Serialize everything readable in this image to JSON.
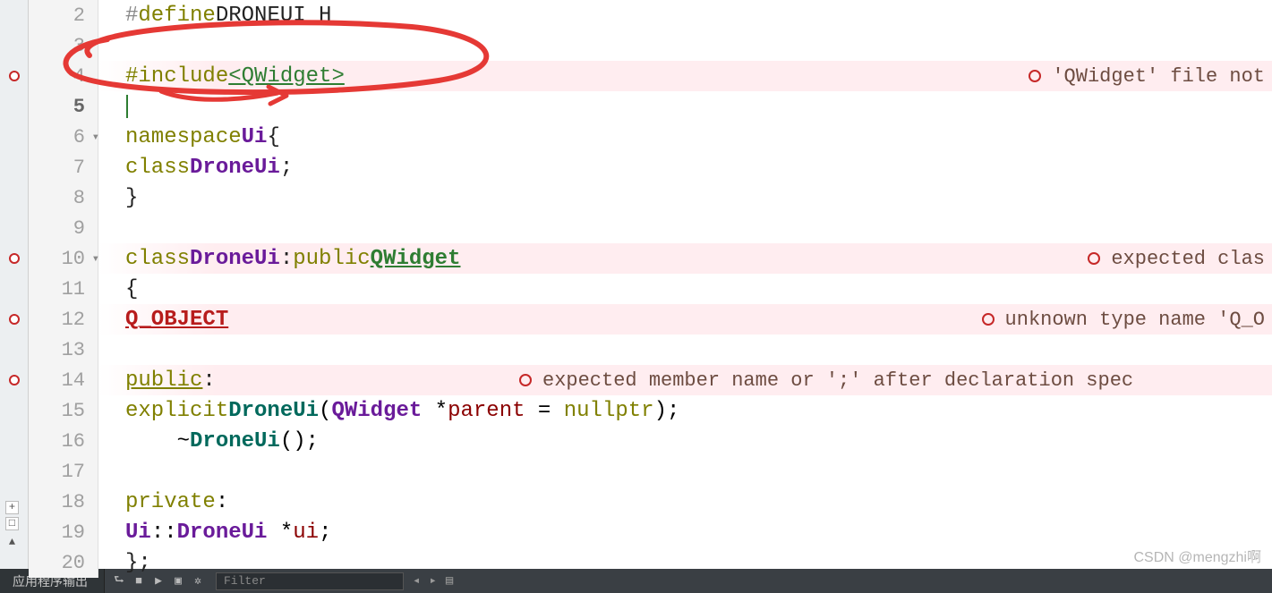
{
  "editor": {
    "lines": [
      {
        "n": 2,
        "break": false,
        "fold": false,
        "err": false,
        "inline": "",
        "html": "<span class='kw-gray'>#</span><span class='kw-olive'>define</span> <span class='kw-black'>DRONEUI_H</span>"
      },
      {
        "n": 3,
        "break": false,
        "fold": false,
        "err": false,
        "inline": "",
        "html": ""
      },
      {
        "n": 4,
        "break": true,
        "fold": false,
        "err": true,
        "inline": "'QWidget' file not",
        "html": "<span class='kw-olive'>#include</span> <span class='kw-green'>&lt;QWidget&gt;</span>"
      },
      {
        "n": 5,
        "break": false,
        "fold": false,
        "err": false,
        "inline": "",
        "html": "<span class='cursor-bar'></span>",
        "current": true
      },
      {
        "n": 6,
        "break": false,
        "fold": true,
        "err": false,
        "inline": "",
        "html": "<span class='kw-olive'>namespace</span> <span class='kw-purple'>Ui</span> <span class='kw-black'>{</span>"
      },
      {
        "n": 7,
        "break": false,
        "fold": false,
        "err": false,
        "inline": "",
        "html": "<span class='kw-olive'>class</span> <span class='kw-purple'>DroneUi</span><span class='kw-black'>;</span>"
      },
      {
        "n": 8,
        "break": false,
        "fold": false,
        "err": false,
        "inline": "",
        "html": "<span class='kw-black'>}</span>"
      },
      {
        "n": 9,
        "break": false,
        "fold": false,
        "err": false,
        "inline": "",
        "html": ""
      },
      {
        "n": 10,
        "break": true,
        "fold": true,
        "err": true,
        "inline": "expected clas",
        "html": "<span class='kw-olive'>class</span> <span class='kw-purple'>DroneUi</span> <span class='kw-black'>:</span> <span class='kw-olive'>public</span> <span class='kw-green-b'>QWidget</span>"
      },
      {
        "n": 11,
        "break": false,
        "fold": false,
        "err": false,
        "inline": "",
        "html": "<span class='kw-black'>{</span>"
      },
      {
        "n": 12,
        "break": true,
        "fold": false,
        "err": true,
        "inline": "unknown type name 'Q_O",
        "html": "    <span class='kw-red-u'>Q_OBJECT</span>"
      },
      {
        "n": 13,
        "break": false,
        "fold": false,
        "err": false,
        "inline": "",
        "html": ""
      },
      {
        "n": 14,
        "break": true,
        "fold": false,
        "err": true,
        "inline": "expected member name or ';' after declaration spec",
        "inline_near": true,
        "html": "<span class='kw-olive' style='text-decoration:underline'>public</span><span class='kw-black'>:</span>"
      },
      {
        "n": 15,
        "break": false,
        "fold": false,
        "err": false,
        "inline": "",
        "html": "    <span class='kw-olive'>explicit</span> <span class='kw-teal'>DroneUi</span>(<span class='kw-purple'>QWidget</span> *<span class='kw-brown'>parent</span> = <span class='kw-olive'>nullptr</span>);"
      },
      {
        "n": 16,
        "break": false,
        "fold": false,
        "err": false,
        "inline": "",
        "html": "    ~<span class='kw-teal'>DroneUi</span>();"
      },
      {
        "n": 17,
        "break": false,
        "fold": false,
        "err": false,
        "inline": "",
        "html": ""
      },
      {
        "n": 18,
        "break": false,
        "fold": false,
        "err": false,
        "inline": "",
        "html": "<span class='kw-olive'>private</span>:"
      },
      {
        "n": 19,
        "break": false,
        "fold": false,
        "err": false,
        "inline": "",
        "html": "    <span class='kw-purple'>Ui</span>::<span class='kw-purple'>DroneUi</span> *<span class='kw-brown'>ui</span>;"
      },
      {
        "n": 20,
        "break": false,
        "fold": false,
        "err": false,
        "inline": "",
        "html": "<span class='kw-black'>};</span>"
      }
    ]
  },
  "statusbar": {
    "output_label": "应用程序输出",
    "filter_placeholder": "Filter"
  },
  "watermark": "CSDN @mengzhi啊",
  "rail": {
    "plus": "+",
    "open": "□",
    "up": "▲"
  }
}
